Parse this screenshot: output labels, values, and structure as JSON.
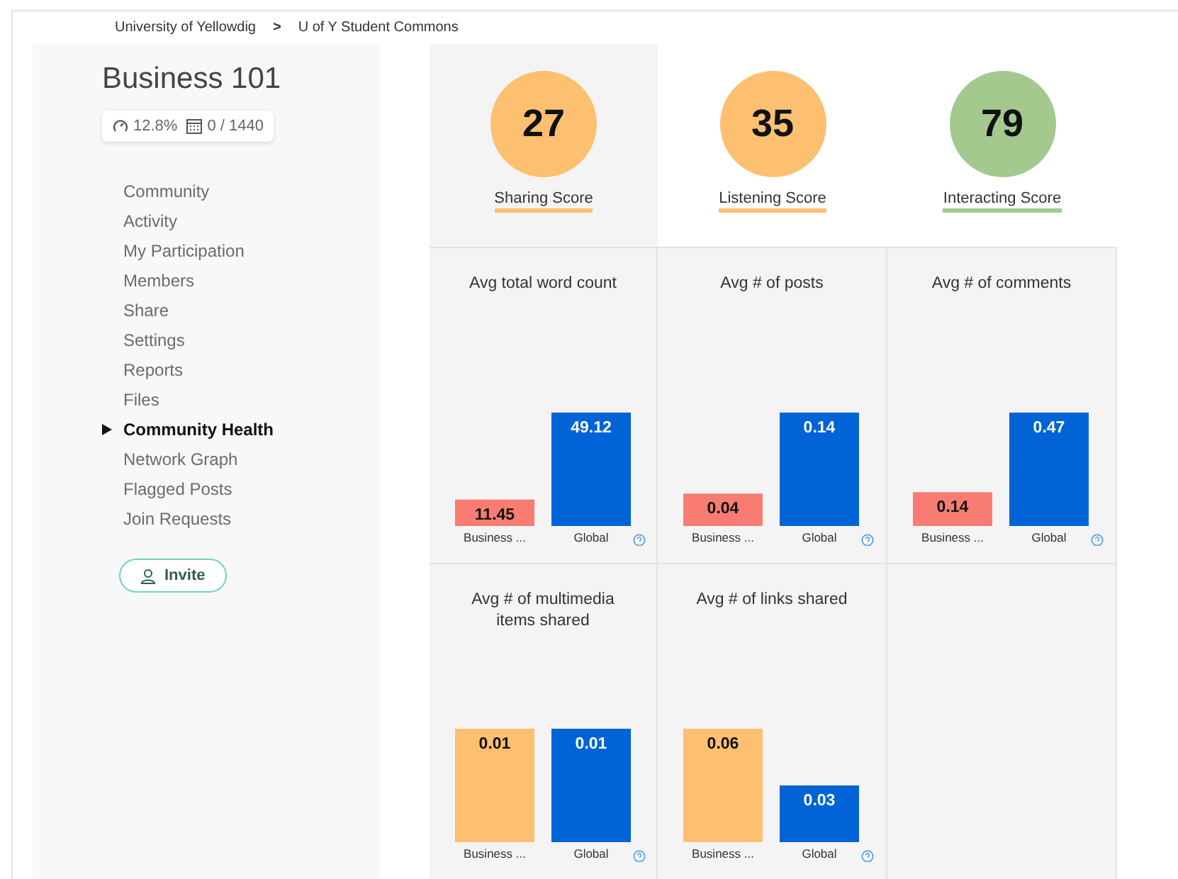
{
  "breadcrumb": [
    {
      "label": "University of Yellowdig"
    },
    {
      "label": "U of Y Student Commons"
    }
  ],
  "breadcrumb_separator": ">",
  "course": {
    "title": "Business 101",
    "progress": "12.8%",
    "posts": "0 / 1440"
  },
  "nav": [
    {
      "label": "Community",
      "selected": false
    },
    {
      "label": "Activity",
      "selected": false
    },
    {
      "label": "My Participation",
      "selected": false
    },
    {
      "label": "Members",
      "selected": false
    },
    {
      "label": "Share",
      "selected": false
    },
    {
      "label": "Settings",
      "selected": false
    },
    {
      "label": "Reports",
      "selected": false
    },
    {
      "label": "Files",
      "selected": false
    },
    {
      "label": "Community Health",
      "selected": true
    },
    {
      "label": "Network Graph",
      "selected": false
    },
    {
      "label": "Flagged Posts",
      "selected": false
    },
    {
      "label": "Join Requests",
      "selected": false
    }
  ],
  "invite_button": "Invite",
  "scores": [
    {
      "value": "27",
      "label": "Sharing Score",
      "color": "#fdc070"
    },
    {
      "value": "35",
      "label": "Listening Score",
      "color": "#fdc070"
    },
    {
      "value": "79",
      "label": "Interacting Score",
      "color": "#a3c98f"
    }
  ],
  "charts": [
    {
      "bars": [
        {
          "color": "#f87c72"
        },
        {
          "color": "#0063d6"
        }
      ],
      "chart_data": {
        "type": "bar",
        "title": "Avg total word count",
        "categories": [
          "Business ...",
          "Global"
        ],
        "values": [
          11.45,
          49.12
        ],
        "data_labels": true
      }
    },
    {
      "bars": [
        {
          "color": "#f87c72"
        },
        {
          "color": "#0063d6"
        }
      ],
      "chart_data": {
        "type": "bar",
        "title": "Avg # of posts",
        "categories": [
          "Business ...",
          "Global"
        ],
        "values": [
          0.04,
          0.14
        ],
        "data_labels": true
      }
    },
    {
      "bars": [
        {
          "color": "#f87c72"
        },
        {
          "color": "#0063d6"
        }
      ],
      "chart_data": {
        "type": "bar",
        "title": "Avg # of comments",
        "categories": [
          "Business ...",
          "Global"
        ],
        "values": [
          0.14,
          0.47
        ],
        "data_labels": true
      }
    },
    {
      "bars": [
        {
          "color": "#fdc070"
        },
        {
          "color": "#0063d6"
        }
      ],
      "chart_data": {
        "type": "bar",
        "title": "Avg # of multimedia items shared",
        "categories": [
          "Business ...",
          "Global"
        ],
        "values": [
          0.01,
          0.01
        ],
        "data_labels": true
      }
    },
    {
      "bars": [
        {
          "color": "#fdc070"
        },
        {
          "color": "#0063d6"
        }
      ],
      "chart_data": {
        "type": "bar",
        "title": "Avg # of links shared",
        "categories": [
          "Business ...",
          "Global"
        ],
        "values": [
          0.06,
          0.03
        ],
        "data_labels": true
      }
    }
  ]
}
